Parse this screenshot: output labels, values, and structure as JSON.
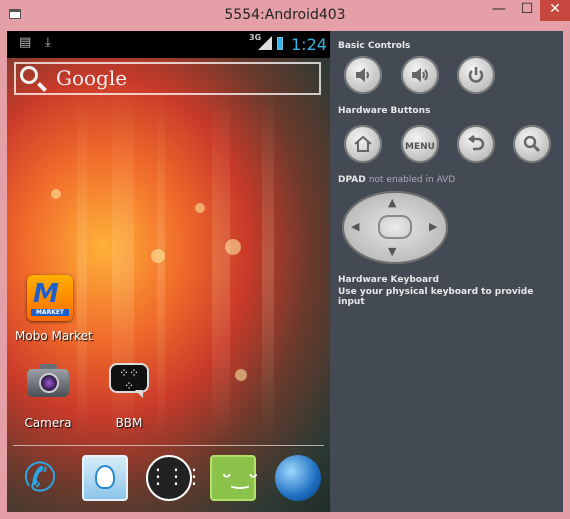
{
  "window": {
    "title": "5554:Android403"
  },
  "titlebar_buttons": {
    "minimize": "—",
    "maximize": "☐",
    "close": "✕"
  },
  "status_bar": {
    "network": "3G",
    "time": "1:24"
  },
  "search": {
    "label": "Google"
  },
  "home_apps": [
    {
      "label": "Mobo Market",
      "icon": "mobo-market-icon"
    },
    {
      "label": "Camera",
      "icon": "camera-icon"
    },
    {
      "label": "BBM",
      "icon": "bbm-icon"
    }
  ],
  "mobo_badge": "MARKET",
  "dock": [
    "phone-icon",
    "contacts-icon",
    "app-drawer-icon",
    "messaging-icon",
    "browser-icon"
  ],
  "panel": {
    "basic_controls": "Basic Controls",
    "hardware_buttons": "Hardware Buttons",
    "menu_label": "MENU",
    "dpad_label": "DPAD",
    "dpad_note": "not enabled in AVD",
    "keyboard_title": "Hardware Keyboard",
    "keyboard_hint": "Use your physical keyboard to provide input"
  },
  "colors": {
    "accent": "#33b5e5",
    "panel_bg": "#434a54",
    "window_frame": "#e5a0a7",
    "close_button": "#c7473f"
  }
}
